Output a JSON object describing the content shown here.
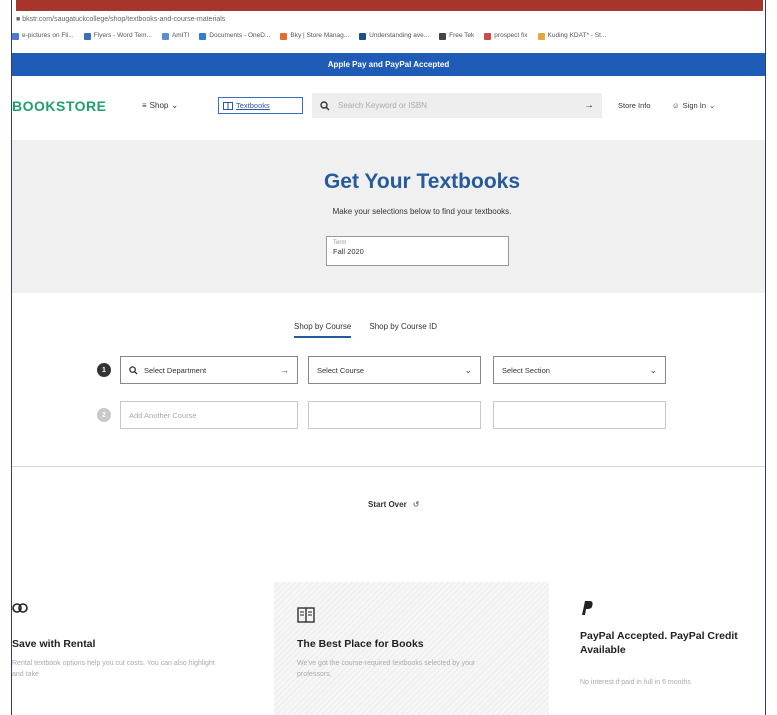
{
  "browser": {
    "url": "bkstr.com/saugatuckcollege/shop/textbooks-and-course-materials",
    "bookmarks": [
      {
        "label": "e-pictures on Fli...",
        "color": "#4d7ad6"
      },
      {
        "label": "Flyers - Word Tem...",
        "color": "#3b6fb9"
      },
      {
        "label": "AmITI",
        "color": "#5b8fd1"
      },
      {
        "label": "Documents - OneD...",
        "color": "#2e7bd4"
      },
      {
        "label": "Bky | Store Manag...",
        "color": "#e36b2c"
      },
      {
        "label": "Understanding ave...",
        "color": "#1f4b8f"
      },
      {
        "label": "Free Tek",
        "color": "#444444"
      },
      {
        "label": "prospect fix",
        "color": "#d14a4a"
      },
      {
        "label": "Kuding KDAT* - St...",
        "color": "#e2a93b"
      }
    ]
  },
  "promo": {
    "text": "Apple Pay and PayPal Accepted"
  },
  "header": {
    "logo": "BOOKSTORE",
    "shop_label": "Shop",
    "textbooks_label": "Textbooks",
    "search_placeholder": "Search Keyword or ISBN",
    "store_info": "Store Info",
    "signin": "Sign In"
  },
  "hero": {
    "title": "Get Your Textbooks",
    "subtitle": "Make your selections below to find your textbooks.",
    "term_label": "Term",
    "term_value": "Fall 2020"
  },
  "tabs": [
    {
      "label": "Shop by Course",
      "active": true
    },
    {
      "label": "Shop by Course ID",
      "active": false
    }
  ],
  "selectors": {
    "row1": {
      "step": "1",
      "department": "Select Department",
      "course": "Select Course",
      "section": "Select Section"
    },
    "row2": {
      "step": "2",
      "add_course": "Add Another Course"
    }
  },
  "actions": {
    "start_over": "Start Over"
  },
  "features": [
    {
      "icon": "rental-icon",
      "title": "Save with Rental",
      "text": "Rental textbook options help you cut costs. You can also highlight and take"
    },
    {
      "icon": "book-icon",
      "title": "The Best Place for Books",
      "text": "We've got the course-required textbooks selected by your professors."
    },
    {
      "icon": "paypal-icon",
      "title": "PayPal Accepted. PayPal Credit Available",
      "text": "No interest if paid in full in 6 months"
    }
  ]
}
